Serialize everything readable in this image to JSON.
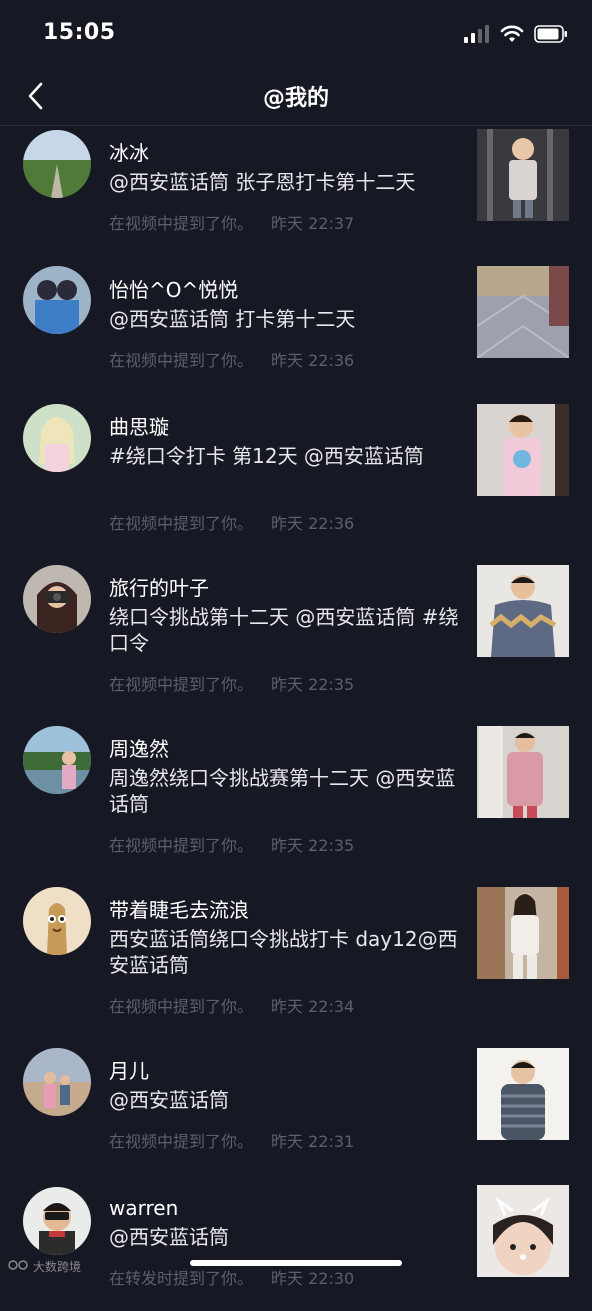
{
  "status": {
    "time": "15:05"
  },
  "nav": {
    "title": "@我的"
  },
  "items": [
    {
      "name": "冰冰",
      "text": "@西安蓝话筒 张子恩打卡第十二天",
      "action": "在视频中提到了你。",
      "time": "昨天 22:37"
    },
    {
      "name": "怡怡^O^悦悦",
      "text": "@西安蓝话筒 打卡第十二天",
      "action": "在视频中提到了你。",
      "time": "昨天 22:36"
    },
    {
      "name": "曲思璇",
      "text": "#绕口令打卡 第12天 @西安蓝话筒",
      "action": "在视频中提到了你。",
      "time": "昨天 22:36"
    },
    {
      "name": "旅行的叶子",
      "text": "绕口令挑战第十二天 @西安蓝话筒 #绕口令",
      "action": "在视频中提到了你。",
      "time": "昨天 22:35"
    },
    {
      "name": "周逸然",
      "text": "周逸然绕口令挑战赛第十二天 @西安蓝话筒",
      "action": "在视频中提到了你。",
      "time": "昨天 22:35"
    },
    {
      "name": "带着睫毛去流浪",
      "text": "西安蓝话筒绕口令挑战打卡 day12@西安蓝话筒",
      "action": "在视频中提到了你。",
      "time": "昨天 22:34"
    },
    {
      "name": "月儿",
      "text": "@西安蓝话筒",
      "action": "在视频中提到了你。",
      "time": "昨天 22:31"
    },
    {
      "name": "warren",
      "text": "@西安蓝话筒",
      "action": "在转发时提到了你。",
      "time": "昨天 22:30"
    }
  ],
  "watermark": "大数跨境",
  "colors": {
    "background": "#161823",
    "meta_text": "#5d5f6a",
    "divider": "#2b2d37"
  }
}
